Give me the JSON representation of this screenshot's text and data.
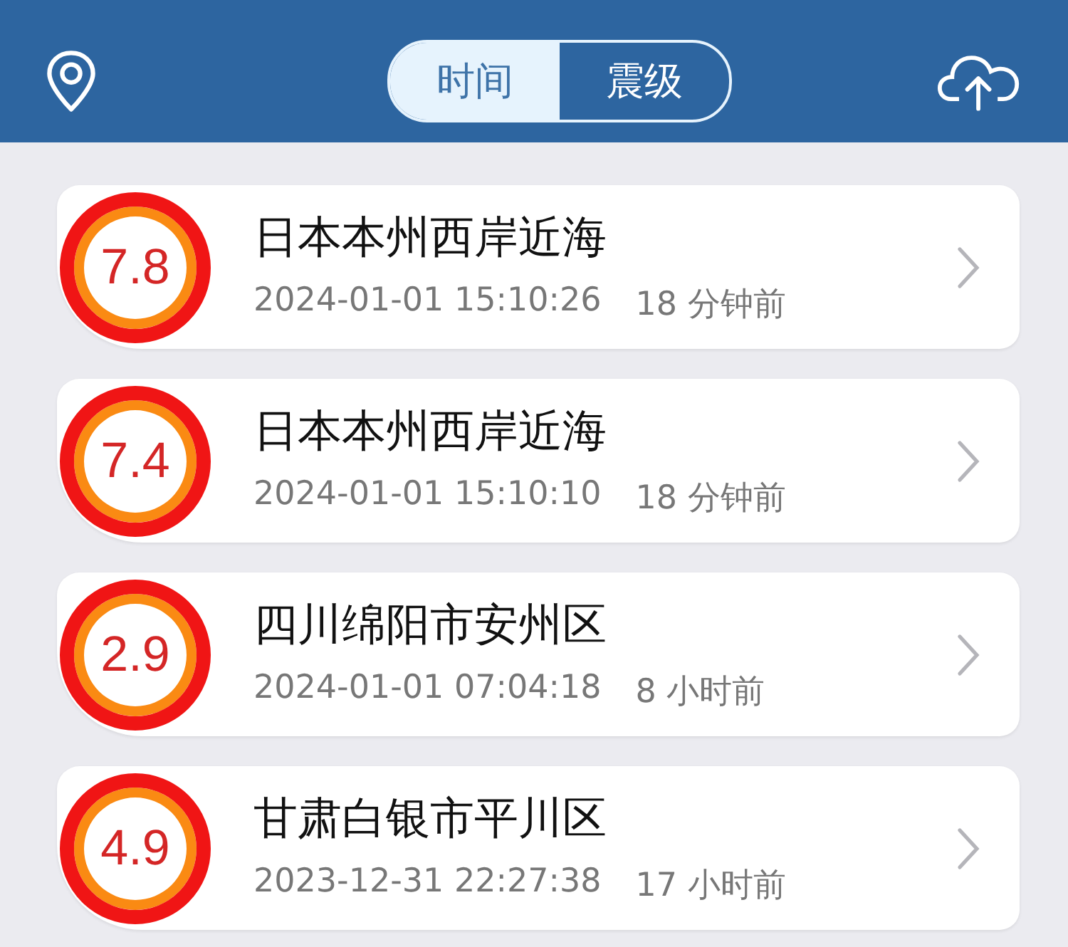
{
  "tabs": [
    {
      "label": "时间",
      "selected": true
    },
    {
      "label": "震级",
      "selected": false
    }
  ],
  "quakes": [
    {
      "magnitude": "7.8",
      "place": "日本本州西岸近海",
      "time": "2024-01-01 15:10:26",
      "ago": "18 分钟前"
    },
    {
      "magnitude": "7.4",
      "place": "日本本州西岸近海",
      "time": "2024-01-01 15:10:10",
      "ago": "18 分钟前"
    },
    {
      "magnitude": "2.9",
      "place": "四川绵阳市安州区",
      "time": "2024-01-01 07:04:18",
      "ago": "8 小时前"
    },
    {
      "magnitude": "4.9",
      "place": "甘肃白银市平川区",
      "time": "2023-12-31 22:27:38",
      "ago": "17 小时前"
    }
  ]
}
